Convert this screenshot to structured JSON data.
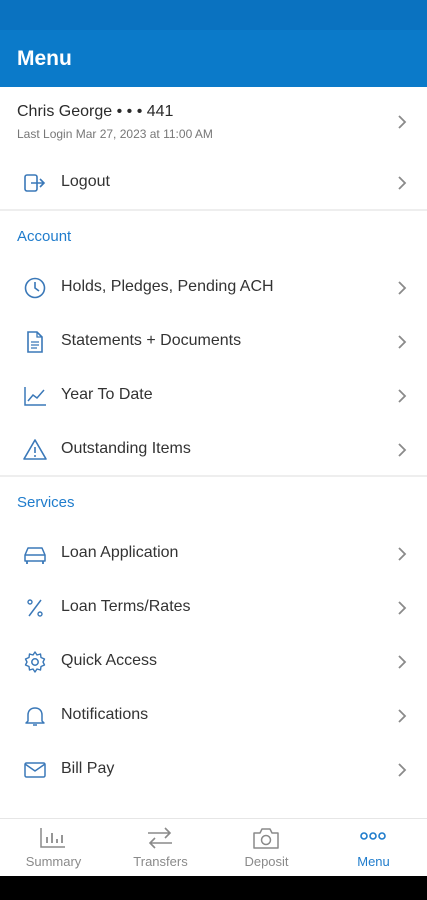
{
  "header": {
    "title": "Menu"
  },
  "profile": {
    "name": "Chris George • • • 441",
    "last_login": "Last Login Mar 27, 2023 at 11:00 AM"
  },
  "logout": {
    "label": "Logout"
  },
  "account": {
    "header": "Account",
    "items": [
      {
        "label": "Holds, Pledges, Pending ACH",
        "icon": "clock-icon"
      },
      {
        "label": "Statements + Documents",
        "icon": "document-icon"
      },
      {
        "label": "Year To Date",
        "icon": "line-chart-icon"
      },
      {
        "label": "Outstanding Items",
        "icon": "warning-icon"
      }
    ]
  },
  "services": {
    "header": "Services",
    "items": [
      {
        "label": "Loan Application",
        "icon": "car-icon"
      },
      {
        "label": "Loan Terms/Rates",
        "icon": "percent-icon"
      },
      {
        "label": "Quick Access",
        "icon": "gear-icon"
      },
      {
        "label": "Notifications",
        "icon": "bell-icon"
      },
      {
        "label": "Bill Pay",
        "icon": "envelope-icon"
      }
    ]
  },
  "tabbar": {
    "tabs": [
      {
        "label": "Summary",
        "icon": "bar-chart-icon"
      },
      {
        "label": "Transfers",
        "icon": "transfer-arrows-icon"
      },
      {
        "label": "Deposit",
        "icon": "camera-icon"
      },
      {
        "label": "Menu",
        "icon": "more-dots-icon",
        "active": true
      }
    ]
  },
  "colors": {
    "header_bg": "#0b7ac9",
    "accent": "#1f7ccc",
    "icon": "#3a78b8"
  }
}
